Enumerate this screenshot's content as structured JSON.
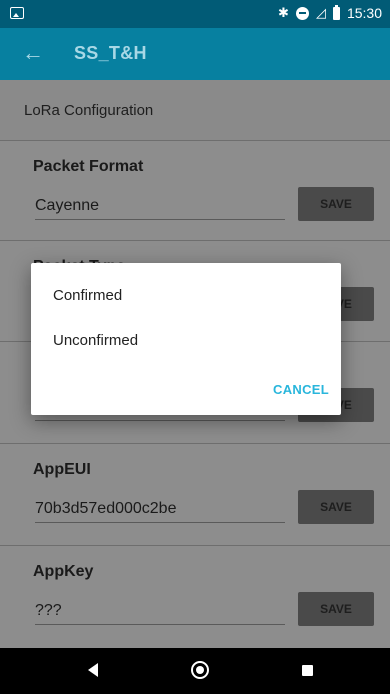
{
  "status_bar": {
    "time": "15:30",
    "icons": [
      "image-icon",
      "bluetooth-icon",
      "do-not-disturb-icon",
      "no-signal-icon",
      "battery-icon"
    ]
  },
  "app_bar": {
    "back_icon": "arrow-left-icon",
    "title": "SS_T&H"
  },
  "section": {
    "title": "LoRa Configuration"
  },
  "rows": [
    {
      "label": "Packet Format",
      "value": "Cayenne",
      "save": "SAVE"
    },
    {
      "label": "Packet Type",
      "value": "",
      "save": "SAVE"
    },
    {
      "label": "",
      "value": "",
      "save": "SAVE"
    },
    {
      "label": "AppEUI",
      "value": "70b3d57ed000c2be",
      "save": "SAVE"
    },
    {
      "label": "AppKey",
      "value": "???",
      "save": "SAVE"
    }
  ],
  "dialog": {
    "options": [
      "Confirmed",
      "Unconfirmed"
    ],
    "cancel": "CANCEL"
  },
  "colors": {
    "status_bar": "#015b76",
    "app_bar": "#0780a0",
    "accent": "#29b6dc"
  }
}
